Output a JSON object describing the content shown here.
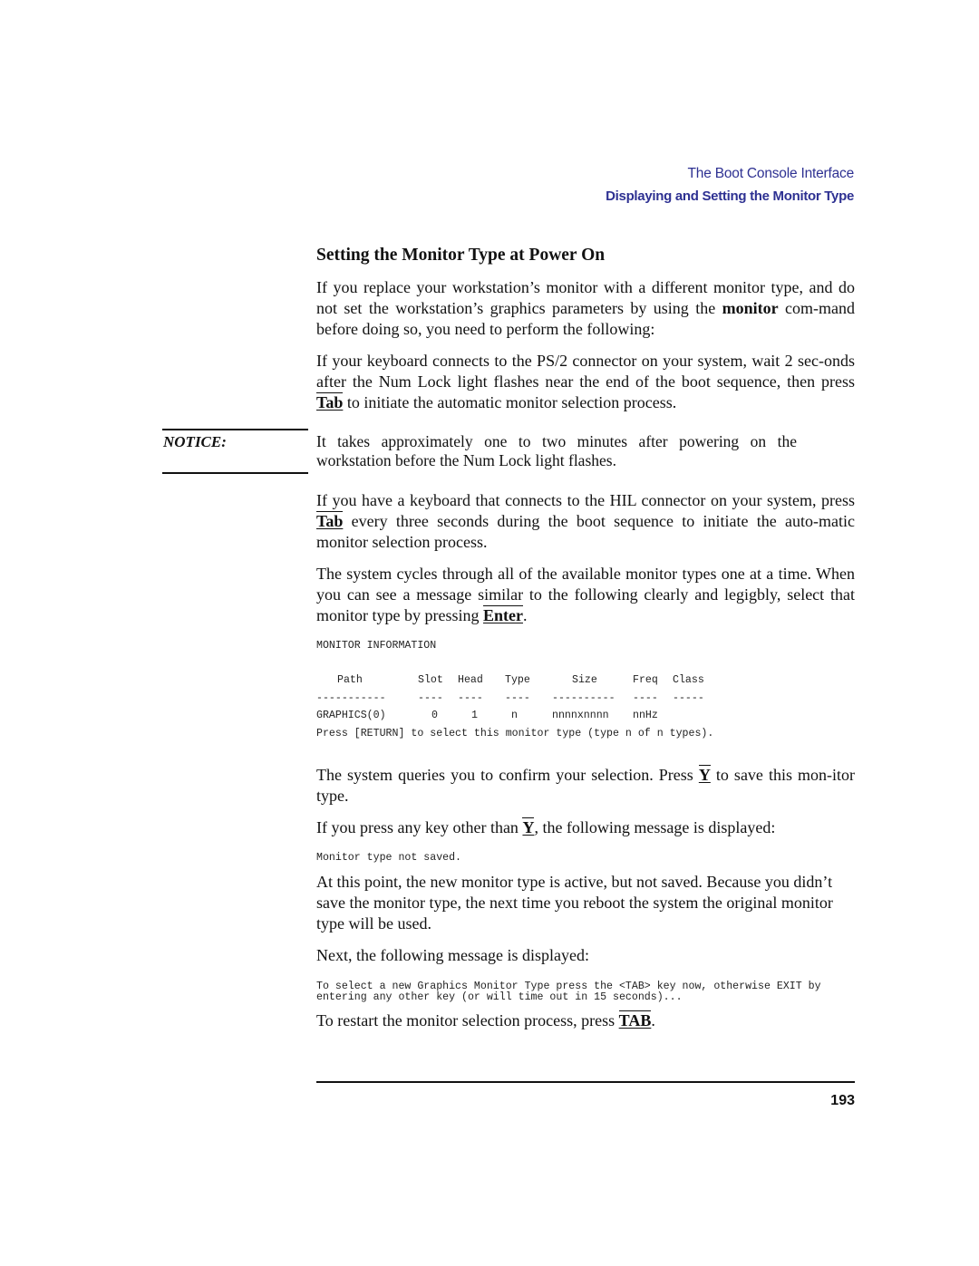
{
  "running_head": {
    "chapter": "The Boot Console Interface",
    "section": "Displaying and Setting the Monitor Type",
    "color": "#2e3192"
  },
  "heading": "Setting the Monitor Type at Power On",
  "paragraphs": {
    "p1": {
      "before": "If you replace your workstation’s monitor with a different monitor type, and do not set the workstation’s graphics parameters by using the ",
      "bold": "monitor",
      "after": " com-mand before doing so, you need to perform the following:"
    },
    "p2": {
      "before": "If your keyboard connects to the PS/2 connector on your system, wait 2 sec-onds after the Num Lock light flashes near the end of the boot sequence, then press ",
      "key": "Tab",
      "after": " to initiate the automatic monitor selection process."
    },
    "p3": {
      "before": "If you have a keyboard that connects to the HIL connector on your system, press ",
      "key": "Tab",
      "after": " every three seconds during the boot sequence to initiate the auto-matic monitor selection process."
    },
    "p4": {
      "before": "The system cycles through all of the available monitor types one at a time. When you can see a message similar to the following clearly and legigbly, select that monitor type by pressing ",
      "key": "Enter",
      "after": "."
    },
    "p5": {
      "before": "The system queries you to confirm your selection. Press ",
      "key": "Y",
      "after": " to save this mon-itor type."
    },
    "p6": {
      "before": "If you press any key other than ",
      "key": "Y",
      "after": ", the following message is displayed:"
    },
    "p7": "At this point, the new monitor type is active, but not saved. Because you didn’t save the monitor type, the next time you reboot the system the original monitor type will be used.",
    "p8": "Next, the following message is displayed:",
    "p9": {
      "before": "To restart the monitor selection process, press ",
      "key": "TAB",
      "after": "."
    }
  },
  "notice": {
    "label": "NOTICE:",
    "text": "It takes approximately one to two minutes after powering on the workstation before the Num Lock light flashes."
  },
  "monitor_info": {
    "title": "MONITOR INFORMATION",
    "columns": [
      "Path",
      "Slot",
      "Head",
      "Type",
      "Size",
      "Freq",
      "Class"
    ],
    "separators": [
      "-----------",
      "----",
      "----",
      "----",
      "----------",
      "----",
      "-----"
    ],
    "row": [
      "GRAPHICS(0)",
      "0",
      "1",
      "n",
      "nnnnxnnnn",
      "nnHz",
      ""
    ],
    "prompt": "Press [RETURN] to select this monitor type (type n of n types)."
  },
  "not_saved_message": "Monitor type not saved.",
  "tab_prompt": {
    "line1": "To select a new Graphics Monitor Type press the <TAB> key now, otherwise EXIT by",
    "line2": "entering any other key (or will time out in 15 seconds)..."
  },
  "page_number": "193"
}
